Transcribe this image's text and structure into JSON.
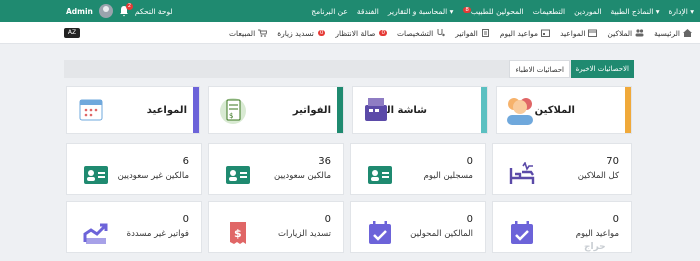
{
  "topbar": {
    "menu": [
      "الإدارة",
      "النماذج الطبية",
      "الموردين",
      "التطعيمات",
      "المحولين للطبيب",
      "المحاسبة و التقارير",
      "الفندقة",
      "عن البرنامج"
    ],
    "menu_badge": "8",
    "control_panel": "لوحة التحكم",
    "notif_count": "2",
    "user": "Admin"
  },
  "toolbar": {
    "items": [
      "الرئيسية",
      "الملاكين",
      "المواعيد",
      "مواعيد اليوم",
      "الفواتير",
      "التشخيصات",
      "صالة الانتظار",
      "تسديد زيارة",
      "المبيعات"
    ],
    "waiting_badge": "0",
    "visit_badge": "0",
    "kbd": "A⁠Z"
  },
  "tabs": {
    "latest": "الاحصائيات الاخيرة",
    "doctors": "احصائيات الاطباء"
  },
  "big_cards": [
    {
      "title": "الملاكين",
      "accent": "#f0a93a"
    },
    {
      "title": "شاشة البيع",
      "accent": "#5bc0c1"
    },
    {
      "title": "الفواتير",
      "accent": "#1f8a70"
    },
    {
      "title": "المواعيد",
      "accent": "#6c63d9"
    }
  ],
  "stats_row1": [
    {
      "value": "70",
      "label": "كل الملاكين"
    },
    {
      "value": "0",
      "label": "مسجلين اليوم"
    },
    {
      "value": "36",
      "label": "مالكين سعوديين"
    },
    {
      "value": "6",
      "label": "مالكين غير سعوديين"
    }
  ],
  "stats_row2": [
    {
      "value": "0",
      "label": "مواعيد اليوم"
    },
    {
      "value": "0",
      "label": "المالكين المحولين"
    },
    {
      "value": "0",
      "label": "تسديد الزيارات"
    },
    {
      "value": "0",
      "label": "فواتير غير مسددة"
    }
  ],
  "watermark": "حراج"
}
